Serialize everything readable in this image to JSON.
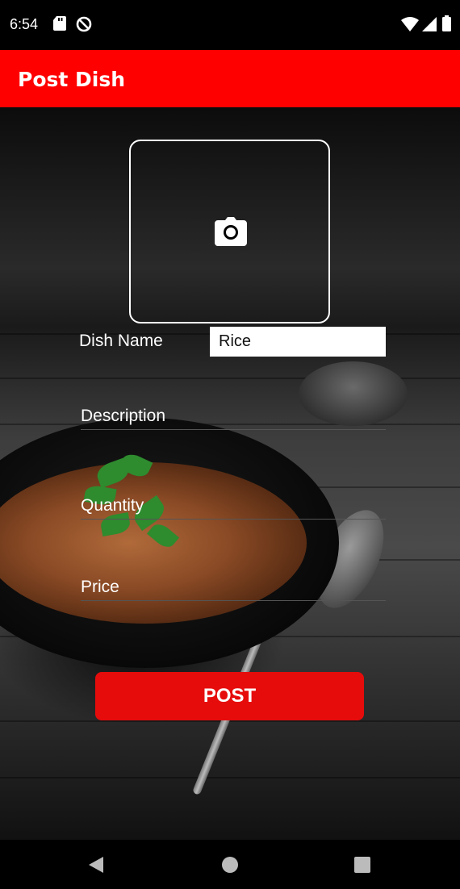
{
  "status_bar": {
    "time": "6:54",
    "left_icons": [
      "sd-card-icon",
      "data-saver-icon"
    ],
    "right_icons": [
      "wifi-icon",
      "signal-icon",
      "battery-icon"
    ]
  },
  "app_bar": {
    "title": "Post Dish",
    "color": "#ff0000"
  },
  "form": {
    "image_picker_icon": "camera-icon",
    "dish_name_label": "Dish Name",
    "dish_name_value": "Rice",
    "description_placeholder": "Description",
    "quantity_placeholder": "Quantity",
    "price_placeholder": "Price",
    "submit_label": "POST",
    "accent_color": "#e60c0c"
  },
  "nav_bar": {
    "buttons": [
      "back-icon",
      "home-icon",
      "recents-icon"
    ]
  }
}
